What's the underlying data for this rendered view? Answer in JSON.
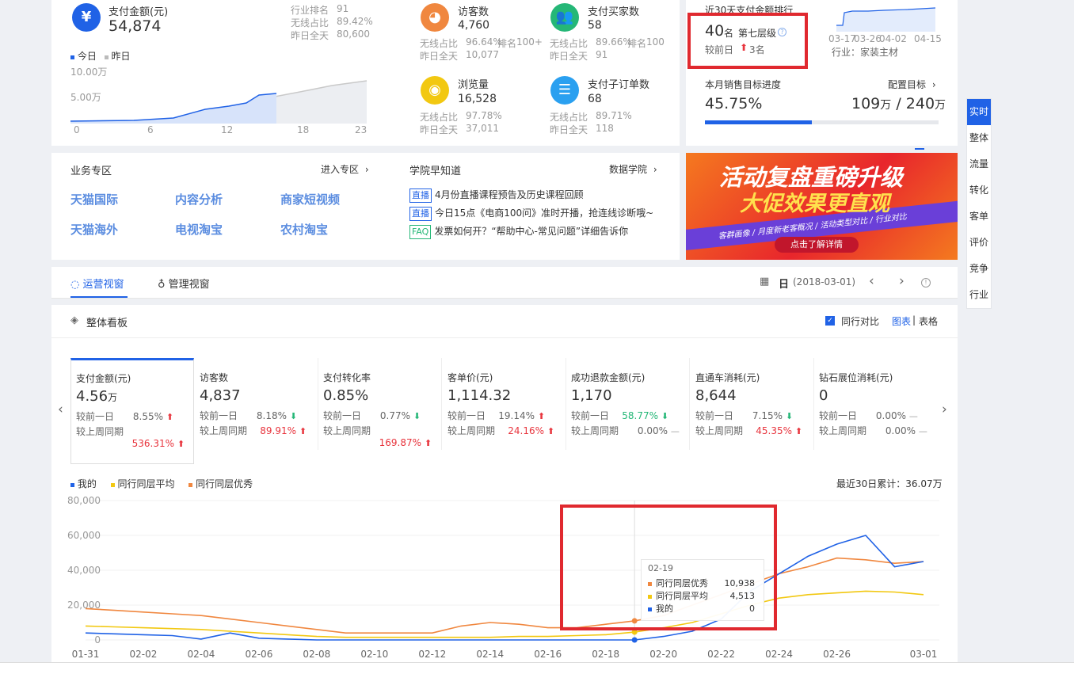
{
  "top": {
    "pay_amount": {
      "label": "支付金额(元)",
      "value": "54,874",
      "industry_rank_label": "行业排名",
      "industry_rank": "91",
      "wireless_label": "无线占比",
      "wireless": "89.42%",
      "yesterday_label": "昨日全天",
      "yesterday": "80,600"
    },
    "legend": {
      "today": "今日",
      "yesterday": "昨日"
    },
    "mini_chart": {
      "y_labels": [
        "10.00万",
        "5.00万"
      ],
      "x_labels": [
        "0",
        "6",
        "12",
        "18",
        "23"
      ]
    },
    "visitors": {
      "label": "访客数",
      "value": "4,760",
      "wireless_label": "无线占比",
      "wireless": "96.64%",
      "rank_label": "排名",
      "rank": "100+",
      "yesterday_label": "昨日全天",
      "yesterday": "10,077"
    },
    "buyers": {
      "label": "支付买家数",
      "value": "58",
      "wireless_label": "无线占比",
      "wireless": "89.66%",
      "rank_label": "排名",
      "rank": "100",
      "yesterday_label": "昨日全天",
      "yesterday": "91"
    },
    "pageviews": {
      "label": "浏览量",
      "value": "16,528",
      "wireless_label": "无线占比",
      "wireless": "97.78%",
      "yesterday_label": "昨日全天",
      "yesterday": "37,011"
    },
    "sub_orders": {
      "label": "支付子订单数",
      "value": "68",
      "wireless_label": "无线占比",
      "wireless": "89.71%",
      "yesterday_label": "昨日全天",
      "yesterday": "118"
    }
  },
  "ranking": {
    "title": "近30天支付金额排行",
    "rank": "40",
    "rank_unit": "名",
    "level": "第七层级",
    "compare_label": "较前日",
    "compare_value": "3名",
    "x_labels": [
      "03-17",
      "03-26",
      "04-02",
      "04-15"
    ],
    "industry_label": "行业：",
    "industry": "家装主材"
  },
  "sales_target": {
    "title": "本月销售目标进度",
    "config_label": "配置目标",
    "percent": "45.75%",
    "progress_fraction": 0.4575,
    "current": "109",
    "target": "240",
    "unit": "万",
    "slash": "/"
  },
  "business_zone": {
    "title": "业务专区",
    "enter_label": "进入专区",
    "links": [
      "天猫国际",
      "内容分析",
      "商家短视频",
      "天猫海外",
      "电视淘宝",
      "农村淘宝"
    ]
  },
  "academy": {
    "title": "学院早知道",
    "link_label": "数据学院",
    "news": [
      {
        "tag": "直播",
        "text": "4月份直播课程预告及历史课程回顾"
      },
      {
        "tag": "直播",
        "text": "今日15点《电商100问》准时开播，抢连线诊断哦~"
      },
      {
        "tag": "FAQ",
        "text": "发票如何开？“帮助中心-常见问题”详细告诉你"
      }
    ]
  },
  "banner": {
    "line1": "活动复盘重磅升级",
    "line2": "大促效果更直观",
    "sub": "客群画像 / 月度新老客概况 / 活动类型对比 / 行业对比",
    "button": "点击了解详情"
  },
  "tabs": {
    "ops": "运营视窗",
    "mgmt": "管理视窗"
  },
  "date_bar": {
    "unit": "日",
    "date": "(2018-03-01)"
  },
  "side_nav": [
    "实时",
    "整体",
    "流量",
    "转化",
    "客单",
    "评价",
    "竞争",
    "行业"
  ],
  "board": {
    "title": "整体看板",
    "compare_label": "同行对比",
    "chart_label": "图表",
    "sep": "|",
    "table_label": "表格"
  },
  "kpis": [
    {
      "title": "支付金额(元)",
      "value": "4.56",
      "unit": "万",
      "r1_label": "较前一日",
      "r1": "8.55%",
      "r1_dir": "up",
      "r2_label": "较上周同期",
      "r2": "536.31%",
      "r2_dir": "up"
    },
    {
      "title": "访客数",
      "value": "4,837",
      "unit": "",
      "r1_label": "较前一日",
      "r1": "8.18%",
      "r1_dir": "down",
      "r2_label": "较上周同期",
      "r2": "89.91%",
      "r2_dir": "up"
    },
    {
      "title": "支付转化率",
      "value": "0.85%",
      "unit": "",
      "r1_label": "较前一日",
      "r1": "0.77%",
      "r1_dir": "down",
      "r2_label": "较上周同期",
      "r2": "169.87%",
      "r2_dir": "up"
    },
    {
      "title": "客单价(元)",
      "value": "1,114.32",
      "unit": "",
      "r1_label": "较前一日",
      "r1": "19.14%",
      "r1_dir": "up",
      "r2_label": "较上周同期",
      "r2": "24.16%",
      "r2_dir": "up"
    },
    {
      "title": "成功退款金额(元)",
      "value": "1,170",
      "unit": "",
      "r1_label": "较前一日",
      "r1": "58.77%",
      "r1_dir": "down",
      "r2_label": "较上周同期",
      "r2": "0.00%",
      "r2_dir": "none"
    },
    {
      "title": "直通车消耗(元)",
      "value": "8,644",
      "unit": "",
      "r1_label": "较前一日",
      "r1": "7.15%",
      "r1_dir": "down",
      "r2_label": "较上周同期",
      "r2": "45.35%",
      "r2_dir": "up"
    },
    {
      "title": "钻石展位消耗(元)",
      "value": "0",
      "unit": "",
      "r1_label": "较前一日",
      "r1": "0.00%",
      "r1_dir": "none",
      "r2_label": "较上周同期",
      "r2": "0.00%",
      "r2_dir": "none"
    }
  ],
  "trend": {
    "cumulative_label": "最近30日累计：",
    "cumulative": "36.07万",
    "tooltip": {
      "date": "02-19",
      "rows": [
        {
          "name": "同行同层优秀",
          "value": "10,938"
        },
        {
          "name": "同行同层平均",
          "value": "4,513"
        },
        {
          "name": "我的",
          "value": "0"
        }
      ]
    }
  },
  "colors": {
    "mine": "#2062e6",
    "avg": "#f2c811",
    "excellent": "#f0873f",
    "accent": "#2062e6",
    "alert": "#e0292f"
  },
  "chart_data": {
    "type": "line",
    "x": [
      "01-31",
      "02-01",
      "02-02",
      "02-03",
      "02-04",
      "02-05",
      "02-06",
      "02-07",
      "02-08",
      "02-09",
      "02-10",
      "02-11",
      "02-12",
      "02-13",
      "02-14",
      "02-15",
      "02-16",
      "02-17",
      "02-18",
      "02-19",
      "02-20",
      "02-21",
      "02-22",
      "02-23",
      "02-24",
      "02-25",
      "02-26",
      "02-27",
      "02-28",
      "03-01"
    ],
    "x_tick_labels": [
      "01-31",
      "02-02",
      "02-04",
      "02-06",
      "02-08",
      "02-10",
      "02-12",
      "02-14",
      "02-16",
      "02-18",
      "02-20",
      "02-22",
      "02-24",
      "02-26",
      "03-01"
    ],
    "y_tick_labels": [
      "80,000",
      "60,000",
      "40,000",
      "20,000",
      "0"
    ],
    "ylim": [
      0,
      80000
    ],
    "series": [
      {
        "name": "我的",
        "color": "#2062e6",
        "values": [
          4000,
          3500,
          3000,
          2500,
          500,
          4000,
          1000,
          500,
          0,
          0,
          0,
          0,
          0,
          0,
          0,
          0,
          0,
          0,
          0,
          0,
          2000,
          5000,
          12000,
          28000,
          38000,
          48000,
          55000,
          60000,
          42000,
          45000
        ]
      },
      {
        "name": "同行同层平均",
        "color": "#f2c811",
        "values": [
          8000,
          7500,
          7000,
          6500,
          6000,
          5000,
          4000,
          3000,
          2000,
          1500,
          1500,
          1500,
          1500,
          1500,
          1500,
          2000,
          2000,
          2500,
          3000,
          4513,
          7000,
          10000,
          15000,
          20000,
          24000,
          26000,
          27000,
          28000,
          27500,
          26000
        ]
      },
      {
        "name": "同行同层优秀",
        "color": "#f0873f",
        "values": [
          18000,
          17000,
          16000,
          15000,
          14000,
          12000,
          10000,
          8000,
          6000,
          4000,
          4000,
          4000,
          4000,
          8000,
          10000,
          9000,
          7000,
          7000,
          9000,
          10938,
          14000,
          20000,
          26000,
          32000,
          38000,
          42000,
          47000,
          46000,
          44000,
          45000
        ]
      }
    ]
  }
}
